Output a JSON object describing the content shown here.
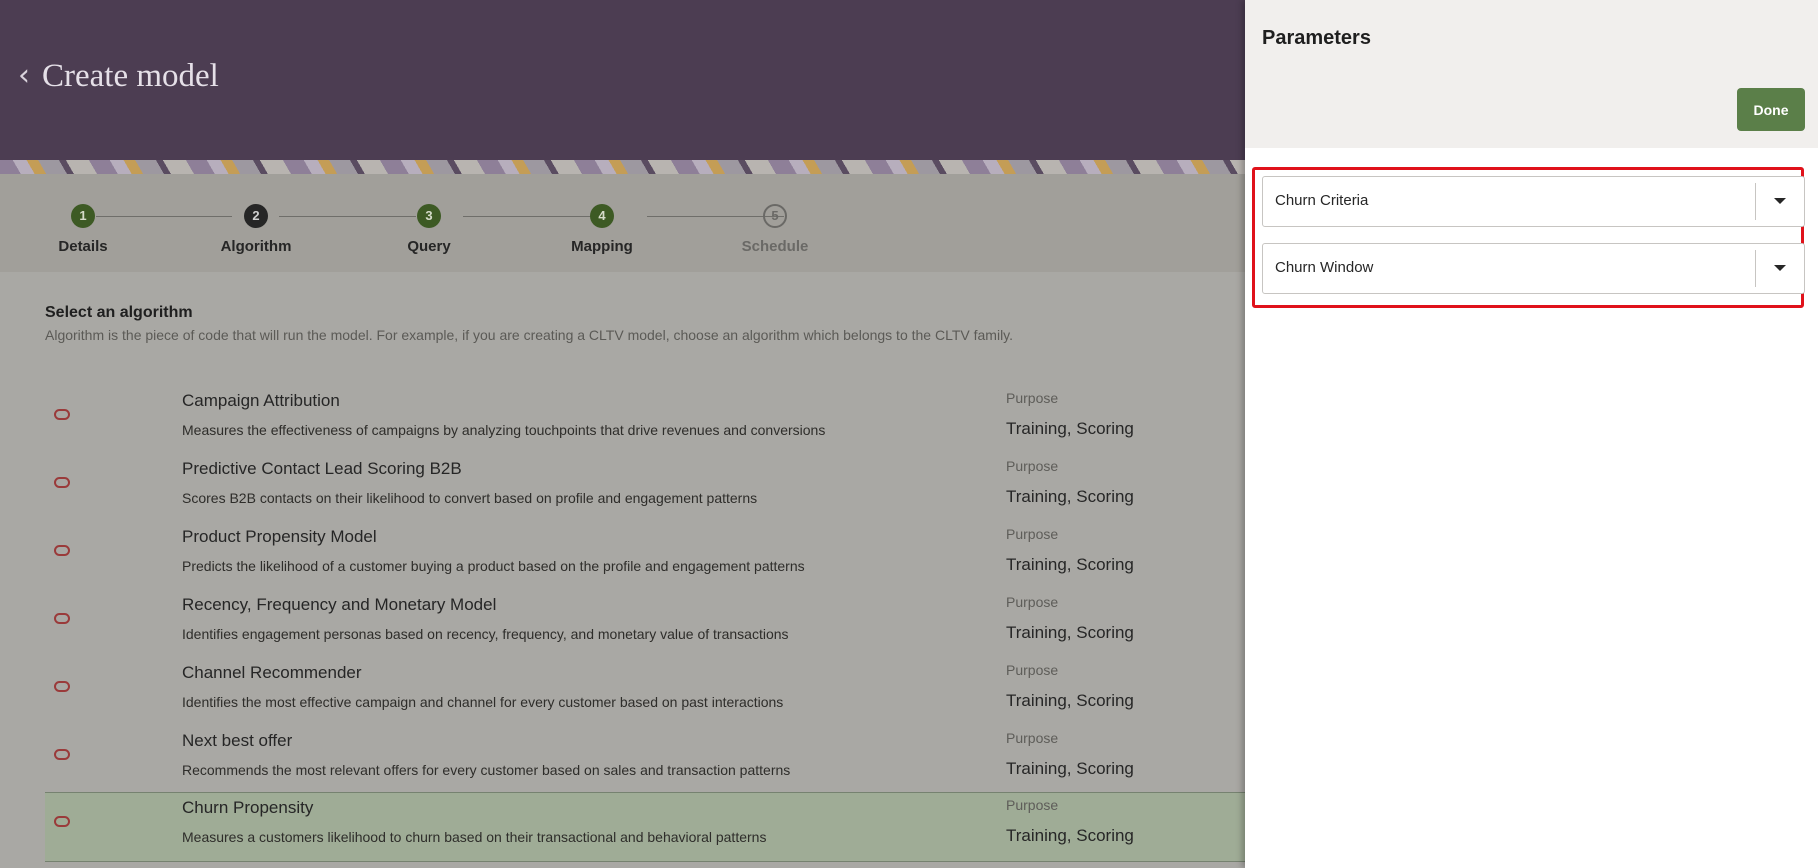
{
  "header": {
    "back_icon": "chevron-left-icon",
    "title": "Create model"
  },
  "stepper": {
    "steps": [
      {
        "number": "1",
        "label": "Details",
        "state": "complete"
      },
      {
        "number": "2",
        "label": "Algorithm",
        "state": "current"
      },
      {
        "number": "3",
        "label": "Query",
        "state": "complete"
      },
      {
        "number": "4",
        "label": "Mapping",
        "state": "complete"
      },
      {
        "number": "5",
        "label": "Schedule",
        "state": "todo"
      }
    ]
  },
  "algorithm_section": {
    "title": "Select an algorithm",
    "description": "Algorithm is the piece of code that will run the model. For example, if you are creating a CLTV model, choose an algorithm which belongs to the CLTV family.",
    "items": [
      {
        "name": "Campaign Attribution",
        "description": "Measures the effectiveness of campaigns by analyzing touchpoints that drive revenues and conversions",
        "purpose_label": "Purpose",
        "purpose": "Training, Scoring",
        "selected": false
      },
      {
        "name": "Predictive Contact Lead Scoring B2B",
        "description": "Scores B2B contacts on their likelihood to convert based on profile and engagement patterns",
        "purpose_label": "Purpose",
        "purpose": "Training, Scoring",
        "selected": false
      },
      {
        "name": "Product Propensity Model",
        "description": "Predicts the likelihood of a customer buying a product based on the profile and engagement patterns",
        "purpose_label": "Purpose",
        "purpose": "Training, Scoring",
        "selected": false
      },
      {
        "name": "Recency, Frequency and Monetary Model",
        "description": "Identifies engagement personas based on recency, frequency, and monetary value of transactions",
        "purpose_label": "Purpose",
        "purpose": "Training, Scoring",
        "selected": false
      },
      {
        "name": "Channel Recommender",
        "description": "Identifies the most effective campaign and channel for every customer based on past interactions",
        "purpose_label": "Purpose",
        "purpose": "Training, Scoring",
        "selected": false
      },
      {
        "name": "Next best offer",
        "description": "Recommends the most relevant offers for every customer based on sales and transaction patterns",
        "purpose_label": "Purpose",
        "purpose": "Training, Scoring",
        "selected": false
      },
      {
        "name": "Churn Propensity",
        "description": "Measures a customers likelihood to churn based on their transactional and behavioral patterns",
        "purpose_label": "Purpose",
        "purpose": "Training, Scoring",
        "selected": true
      }
    ]
  },
  "parameters_panel": {
    "title": "Parameters",
    "done_label": "Done",
    "selects": [
      {
        "value": "Churn Criteria",
        "icon": "chevron-down-icon"
      },
      {
        "value": "Churn Window",
        "icon": "chevron-down-icon"
      }
    ],
    "highlight_color": "#e0121b"
  },
  "colors": {
    "header_bg": "#4c3d52",
    "accent_green": "#5b7f49",
    "selected_row_bg": "#9fac96"
  }
}
